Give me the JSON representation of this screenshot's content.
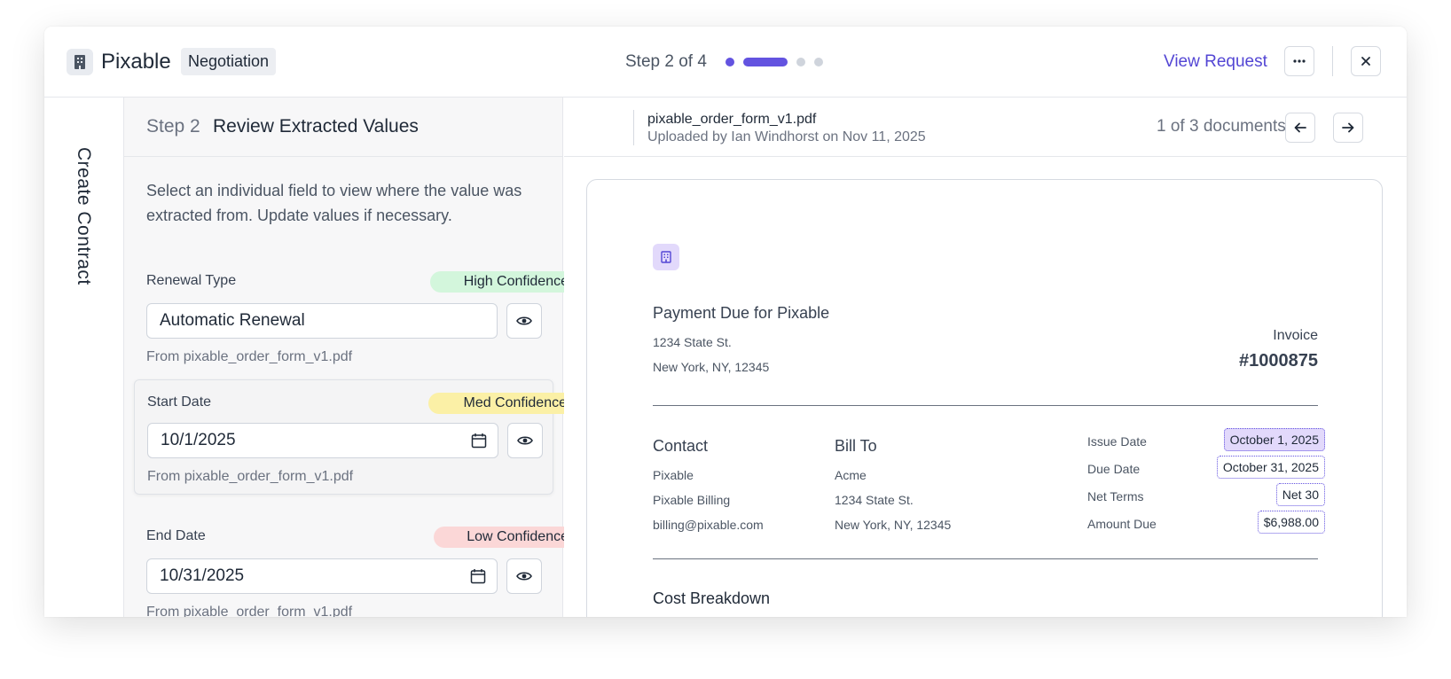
{
  "header": {
    "app_name": "Pixable",
    "stage_badge": "Negotiation",
    "step_text": "Step 2 of 4",
    "view_request": "View Request",
    "accent_color": "#6353e0"
  },
  "rail": {
    "label": "Create Contract"
  },
  "left": {
    "step_no": "Step 2",
    "step_title": "Review Extracted Values",
    "intro": "Select an individual field to view where the value was extracted from. Update values if necessary.",
    "fields": [
      {
        "label": "Renewal Type",
        "confidence": "High Confidence",
        "value": "Automatic Renewal",
        "source": "From pixable_order_form_v1.pdf"
      },
      {
        "label": "Start Date",
        "confidence": "Med Confidence",
        "value": "10/1/2025",
        "source": "From pixable_order_form_v1.pdf"
      },
      {
        "label": "End Date",
        "confidence": "Low Confidence",
        "value": "10/31/2025",
        "source": "From pixable_order_form_v1.pdf"
      }
    ]
  },
  "doc": {
    "file_name": "pixable_order_form_v1.pdf",
    "uploaded": "Uploaded by Ian Windhorst on Nov 11, 2025",
    "count": "1 of 3 documents",
    "invoice": {
      "title": "Payment Due for Pixable",
      "addr1": "1234 State St.",
      "addr2": "New York, NY, 12345",
      "label": "Invoice",
      "number": "#1000875",
      "contact_head": "Contact",
      "contact_lines": [
        "Pixable",
        "Pixable Billing",
        "billing@pixable.com"
      ],
      "billto_head": "Bill To",
      "billto_lines": [
        "Acme",
        "1234 State St.",
        "New York, NY, 12345"
      ],
      "kv": [
        {
          "label": "Issue Date",
          "value": "October 1, 2025"
        },
        {
          "label": "Due Date",
          "value": "October 31, 2025"
        },
        {
          "label": "Net Terms",
          "value": "Net 30"
        },
        {
          "label": "Amount Due",
          "value": "$6,988.00"
        }
      ],
      "cost_head": "Cost Breakdown"
    }
  }
}
